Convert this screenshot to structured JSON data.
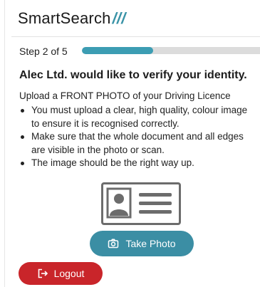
{
  "brand": {
    "name": "SmartSearch",
    "mark": "///",
    "mark_color": "#3a93a7"
  },
  "progress": {
    "label": "Step 2 of 5",
    "current_step": 2,
    "total_steps": 5,
    "fill_fraction": 0.4,
    "fill_color": "#3c9db3"
  },
  "heading": "Alec Ltd. would like to verify your identity.",
  "instructions": {
    "intro": "Upload a FRONT PHOTO of your Driving Licence",
    "bullets": [
      "You must upload a clear, high quality, colour image to ensure it is recognised correctly.",
      "Make sure that the whole document and all edges are visible in the photo or scan.",
      "The image should be the right way up."
    ]
  },
  "illustration": {
    "icon": "driving-licence-icon"
  },
  "buttons": {
    "take_photo": {
      "label": "Take Photo",
      "icon": "camera-icon",
      "color": "#3b8ea4"
    },
    "logout": {
      "label": "Logout",
      "icon": "logout-icon",
      "color": "#c9252a"
    }
  }
}
